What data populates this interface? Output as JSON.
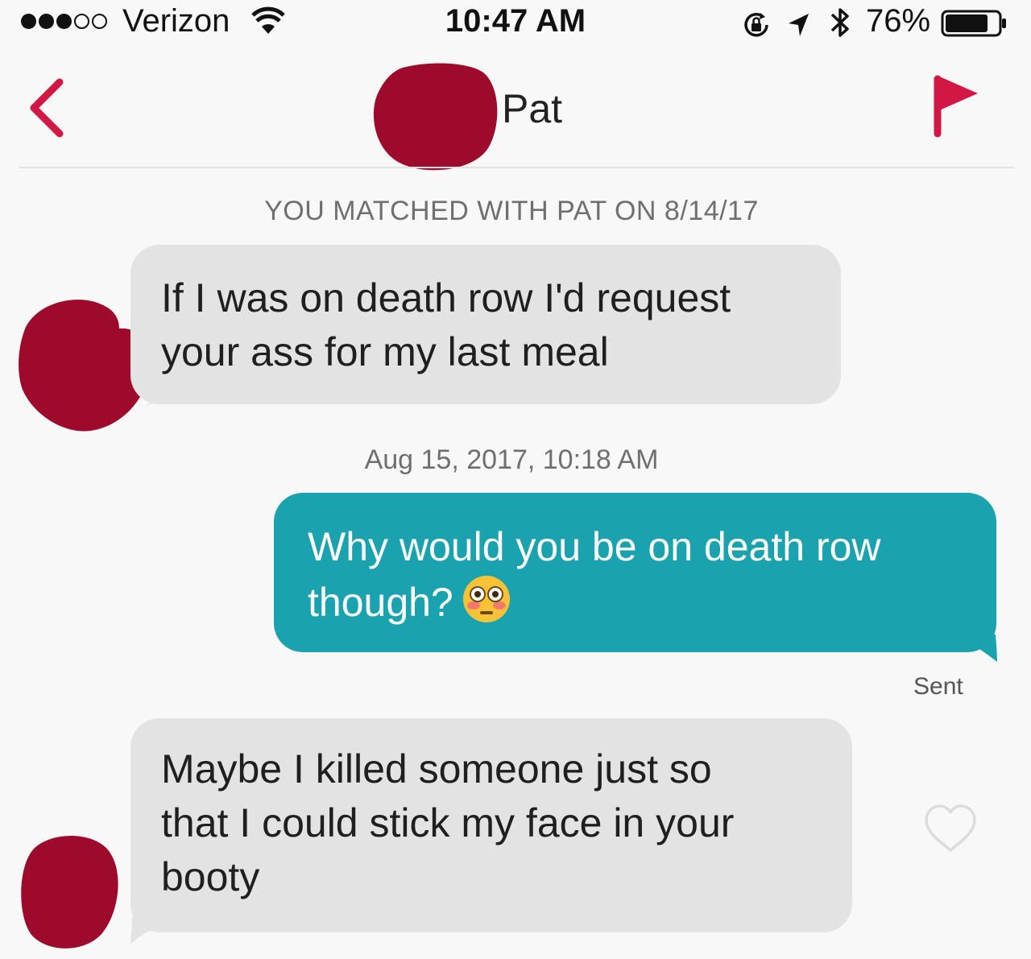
{
  "status_bar": {
    "carrier": "Verizon",
    "time": "10:47 AM",
    "battery_percent": "76%",
    "signal_bars_filled": 3,
    "signal_bars_total": 5,
    "battery_level": 0.76,
    "icons": [
      "wifi-icon",
      "orientation-lock-icon",
      "location-arrow-icon",
      "bluetooth-icon",
      "battery-icon"
    ]
  },
  "header": {
    "contact_name": "Pat",
    "back_icon": "chevron-left-icon",
    "report_icon": "flag-icon"
  },
  "conversation": {
    "match_notice": "YOU MATCHED WITH PAT ON 8/14/17",
    "timestamp": "Aug 15, 2017, 10:18 AM",
    "messages": [
      {
        "direction": "incoming",
        "lines": [
          "If I was on death row I'd request",
          "your ass for my last meal"
        ]
      },
      {
        "direction": "outgoing",
        "lines": [
          "Why would you be on death row",
          "though?"
        ],
        "emoji": "flushed-face-emoji"
      },
      {
        "direction": "incoming",
        "lines": [
          "Maybe I killed someone just so",
          "that I could stick my face in your",
          "booty"
        ],
        "liked": false
      }
    ],
    "sent_status": "Sent"
  },
  "colors": {
    "accent": "#d21745",
    "outgoing_bubble": "#1aa3ae",
    "incoming_bubble": "#e3e3e3",
    "redaction": "#9d0a2c",
    "background": "#f8f8f8"
  }
}
